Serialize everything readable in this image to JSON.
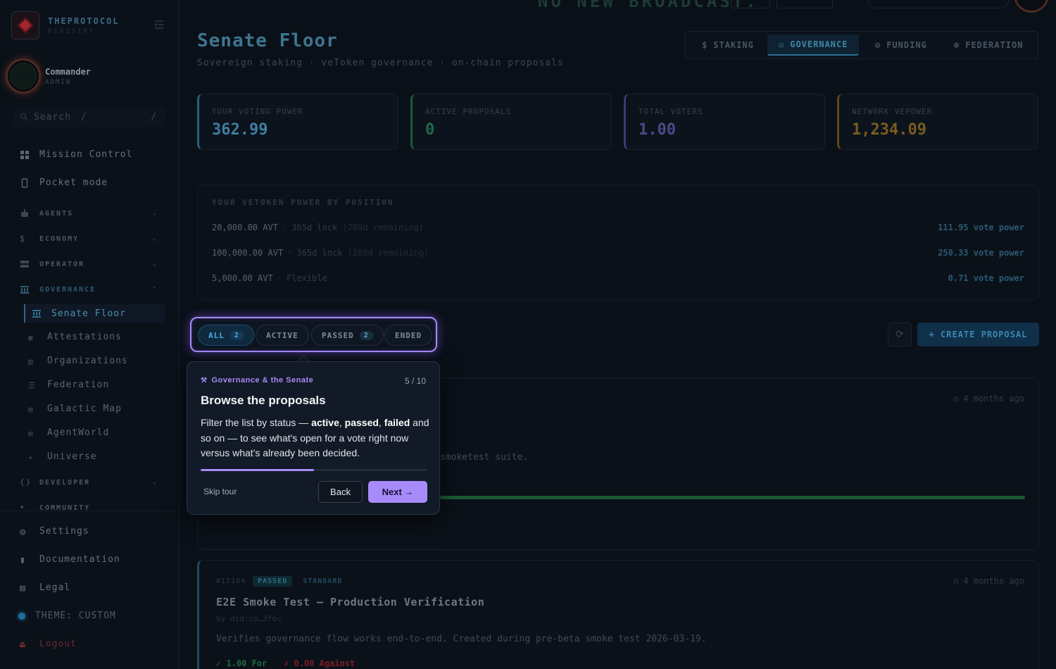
{
  "brand": {
    "name": "THEPROTOCOL",
    "sub": "REGISTRY"
  },
  "user": {
    "name": "Commander",
    "role": "ADMIN"
  },
  "search": {
    "placeholder": "Search",
    "shortcut": "/",
    "shortcut2": "/"
  },
  "nav": {
    "mission_control": "Mission Control",
    "pocket_mode": "Pocket mode",
    "groups": {
      "agents": "AGENTS",
      "economy": "ECONOMY",
      "operator": "OPERATOR",
      "governance": "GOVERNANCE",
      "developer": "DEVELOPER",
      "community": "COMMUNITY"
    },
    "governance_items": [
      "Senate Floor",
      "Attestations",
      "Organizations",
      "Federation",
      "Galactic Map",
      "AgentWorld",
      "Universe"
    ],
    "settings": "Settings",
    "documentation": "Documentation",
    "legal": "Legal",
    "theme": "THEME: CUSTOM",
    "logout": "Logout"
  },
  "ticker": "NO NEW BROADCAST.",
  "page": {
    "title": "Senate Floor",
    "subtitle": "Sovereign staking · veToken governance · on-chain proposals"
  },
  "tabs": [
    {
      "label": "STAKING",
      "icon": "$"
    },
    {
      "label": "GOVERNANCE",
      "icon": "☑"
    },
    {
      "label": "FUNDING",
      "icon": "⊙"
    },
    {
      "label": "FEDERATION",
      "icon": "⊕"
    }
  ],
  "stats": [
    {
      "label": "YOUR VOTING POWER",
      "value": "362.99",
      "color": "#3e7fa0"
    },
    {
      "label": "ACTIVE PROPOSALS",
      "value": "0",
      "color": "#1f6b45"
    },
    {
      "label": "TOTAL VOTERS",
      "value": "1.00",
      "color": "#4b4a86"
    },
    {
      "label": "NETWORK VEPOWER",
      "value": "1,234.09",
      "color": "#7a5c1e"
    }
  ],
  "positions": {
    "title": "YOUR VETOKEN POWER BY POSITION",
    "rows": [
      {
        "amount": "20,000.00 AVT",
        "lock": "365d lock",
        "remaining": "(289d remaining)",
        "power": "111.95 vote power"
      },
      {
        "amount": "100,000.00 AVT",
        "lock": "365d lock",
        "remaining": "(289d remaining)",
        "power": "250.33 vote power"
      },
      {
        "amount": "5,000.00 AVT",
        "lock": "Flexible",
        "remaining": "",
        "power": "0.71 vote power"
      }
    ]
  },
  "filters": [
    {
      "label": "ALL",
      "count": "2"
    },
    {
      "label": "ACTIVE",
      "count": ""
    },
    {
      "label": "PASSED",
      "count": "2"
    },
    {
      "label": "ENDED",
      "count": ""
    }
  ],
  "actions": {
    "create": "+ CREATE PROPOSAL",
    "refresh_icon": "refresh-icon"
  },
  "cards": [
    {
      "time": "4 months ago",
      "desc_tail": "smoketest suite."
    },
    {
      "id": "#12104",
      "status": "PASSED",
      "type": "STANDARD",
      "time": "4 months ago",
      "title": "E2E Smoke Test — Production Verification",
      "by": "by did:co…3f6c",
      "desc": "Verifies governance flow works end-to-end. Created during pre-beta smoke test 2026-03-19.",
      "for": "✓ 1.00 For",
      "against": "✗ 0.00 Against"
    }
  ],
  "tour": {
    "kicker": "Governance & the Senate",
    "step": "5 / 10",
    "progress": 0.5,
    "title": "Browse the proposals",
    "body_1": "Filter the list by status — ",
    "active": "active",
    "comma1": ", ",
    "passed": "passed",
    "comma2": ", ",
    "failed": "failed",
    "body_2": " and so on — to see what's open for a vote right now versus what's already been decided.",
    "skip": "Skip tour",
    "back": "Back",
    "next": "Next →"
  }
}
